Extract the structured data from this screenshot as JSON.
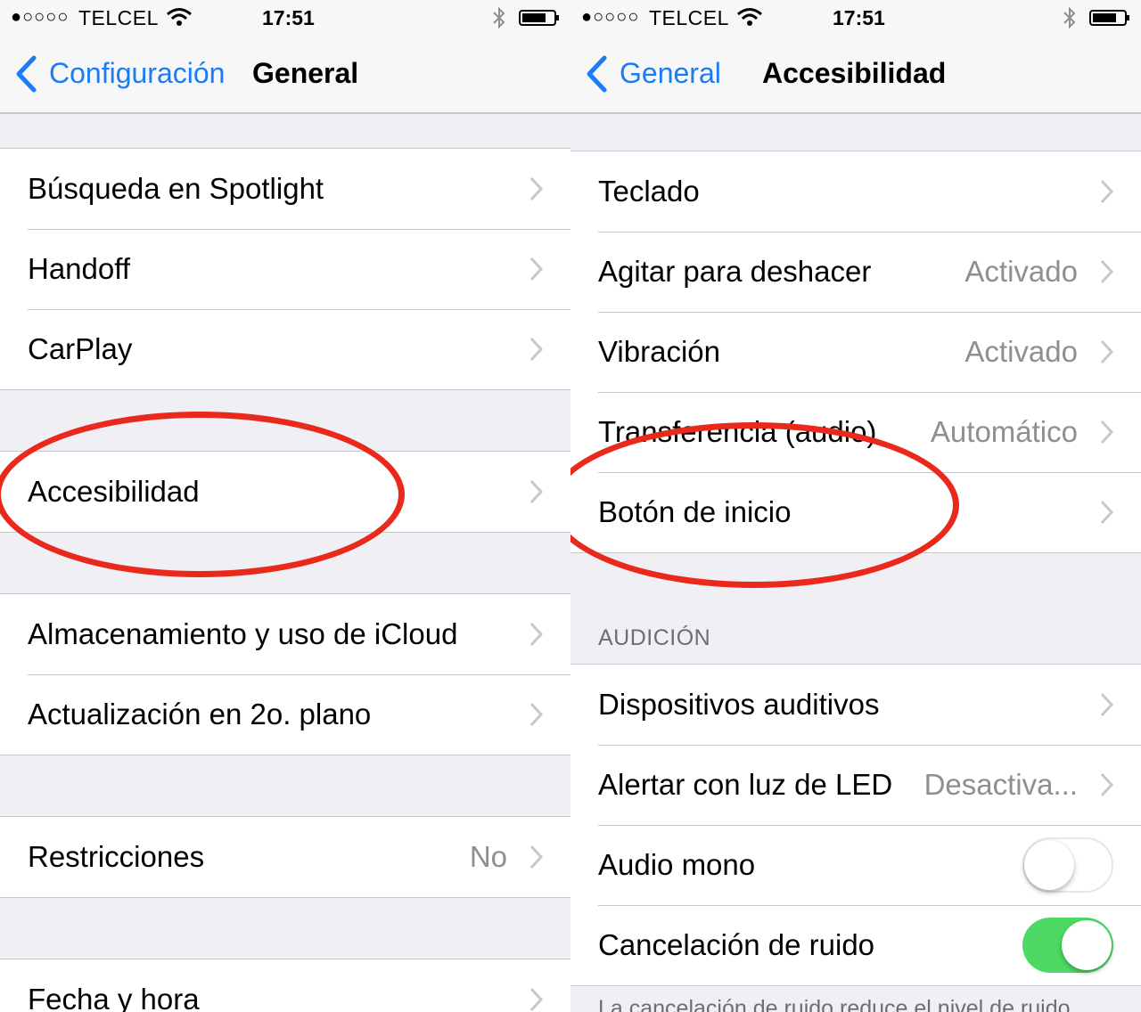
{
  "accent_color": "#1a7cf6",
  "highlight_color": "#e8291c",
  "left": {
    "status_bar": {
      "signal": "●○○○○",
      "carrier": "TELCEL",
      "time": "17:51"
    },
    "nav": {
      "back_label": "Configuración",
      "title": "General"
    },
    "group1": [
      {
        "label": "Búsqueda en Spotlight"
      },
      {
        "label": "Handoff"
      },
      {
        "label": "CarPlay"
      }
    ],
    "group2": [
      {
        "label": "Accesibilidad"
      }
    ],
    "group3": [
      {
        "label": "Almacenamiento y uso de iCloud"
      },
      {
        "label": "Actualización en 2o. plano"
      }
    ],
    "group4": [
      {
        "label": "Restricciones",
        "value": "No"
      }
    ],
    "group5": [
      {
        "label": "Fecha y hora"
      }
    ]
  },
  "right": {
    "status_bar": {
      "signal": "●○○○○",
      "carrier": "TELCEL",
      "time": "17:51"
    },
    "nav": {
      "back_label": "General",
      "title": "Accesibilidad"
    },
    "group1": [
      {
        "label": "Teclado"
      },
      {
        "label": "Agitar para deshacer",
        "value": "Activado"
      },
      {
        "label": "Vibración",
        "value": "Activado"
      },
      {
        "label": "Transferencia (audio)",
        "value": "Automático"
      },
      {
        "label": "Botón de inicio"
      }
    ],
    "section_audicion": "AUDICIÓN",
    "group2": [
      {
        "label": "Dispositivos auditivos"
      },
      {
        "label": "Alertar con luz de LED",
        "value": "Desactiva..."
      },
      {
        "label": "Audio mono",
        "toggle": false
      },
      {
        "label": "Cancelación de ruido",
        "toggle": true
      }
    ],
    "footer": "La cancelación de ruido reduce el nivel de ruido"
  }
}
